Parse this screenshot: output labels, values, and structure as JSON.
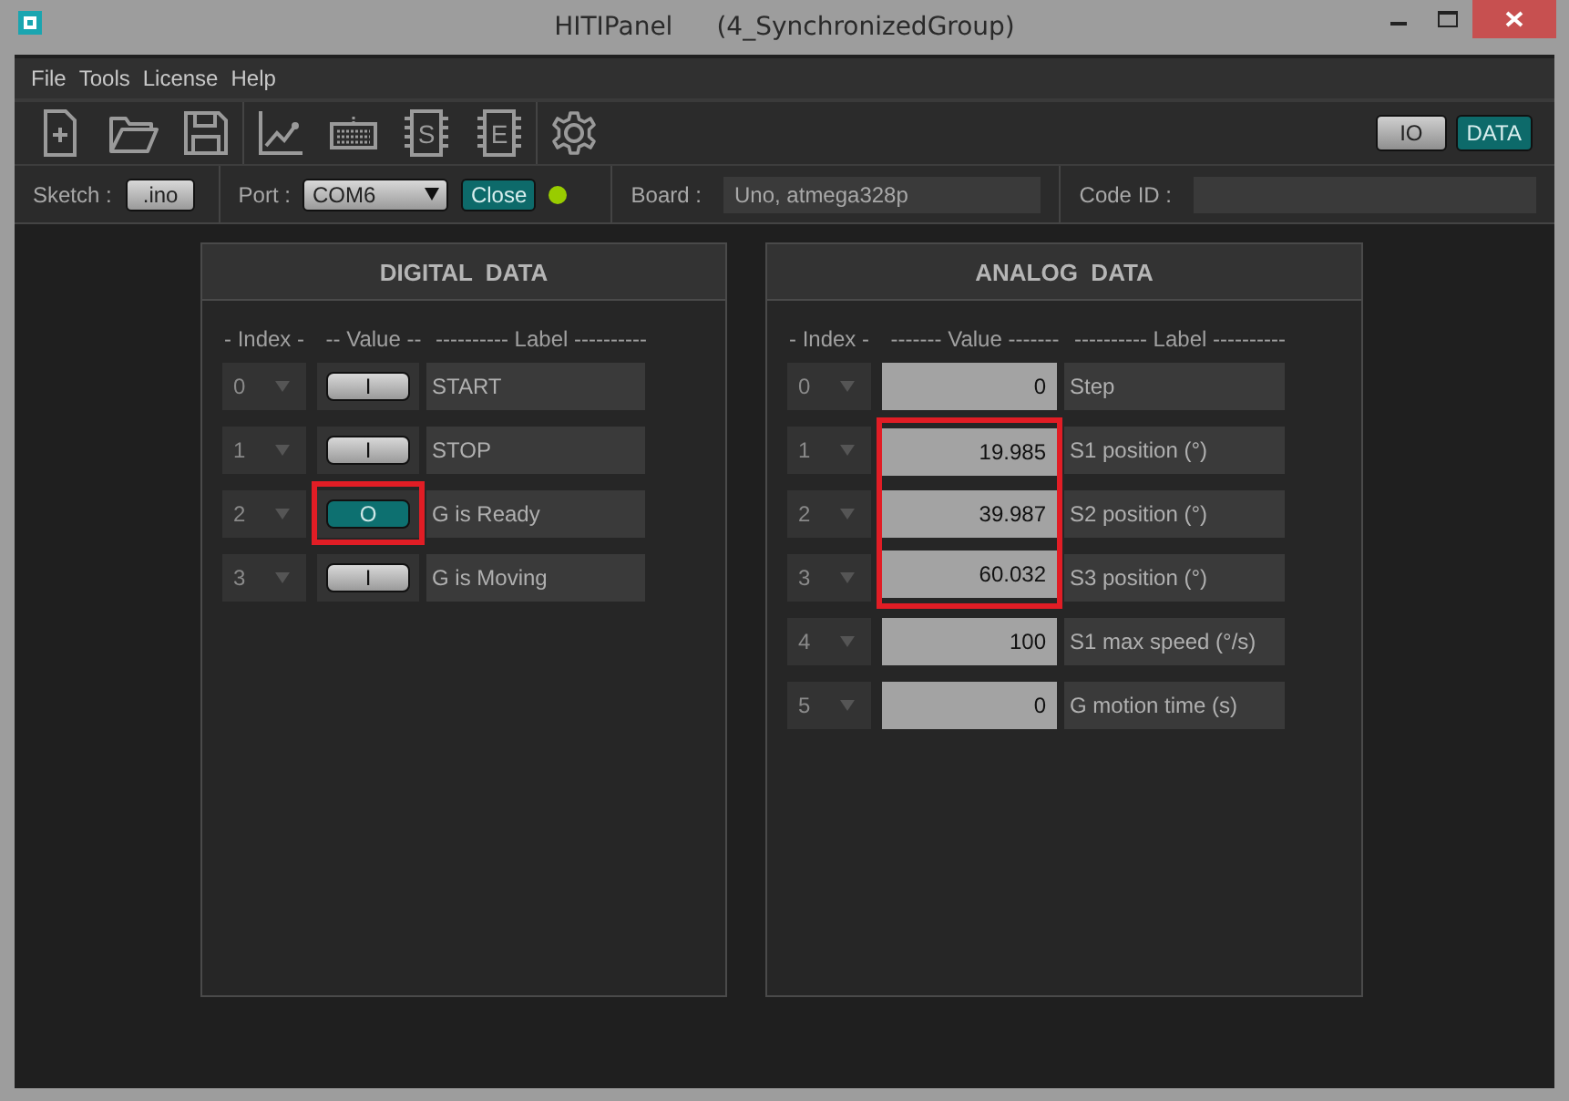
{
  "window": {
    "title": "HITIPanel",
    "document": "(4_SynchronizedGroup)"
  },
  "menu": [
    "File",
    "Tools",
    "License",
    "Help"
  ],
  "toolbar": [
    {
      "kind": "new"
    },
    {
      "kind": "open"
    },
    {
      "kind": "save"
    },
    {
      "kind": "sep"
    },
    {
      "kind": "chart"
    },
    {
      "kind": "keyboard"
    },
    {
      "kind": "chip",
      "label": "S"
    },
    {
      "kind": "chip",
      "label": "E"
    },
    {
      "kind": "sep"
    },
    {
      "kind": "gear"
    }
  ],
  "views": [
    {
      "label": "IO",
      "selected": false
    },
    {
      "label": "DATA",
      "selected": true
    }
  ],
  "connection": {
    "sketch_label": "Sketch :",
    "sketch_button": ".ino",
    "port_label": "Port :",
    "port": "COM6",
    "close_button": "Close",
    "connected": true,
    "board_label": "Board :",
    "board": "Uno, atmega328p",
    "code_id_label": "Code ID :"
  },
  "digital": {
    "title": "DIGITAL  DATA",
    "columns": [
      "- Index -",
      "-- Value --",
      "---------- Label ----------"
    ],
    "rows": [
      {
        "index": "0",
        "value": "I",
        "on": false,
        "label": "START",
        "highlighted": false
      },
      {
        "index": "1",
        "value": "I",
        "on": false,
        "label": "STOP",
        "highlighted": false
      },
      {
        "index": "2",
        "value": "O",
        "on": true,
        "label": "G is Ready",
        "highlighted": true
      },
      {
        "index": "3",
        "value": "I",
        "on": false,
        "label": "G is Moving",
        "highlighted": false
      }
    ]
  },
  "analog": {
    "title": "ANALOG  DATA",
    "columns": [
      "- Index -",
      "------- Value -------",
      "---------- Label ----------"
    ],
    "rows": [
      {
        "index": "0",
        "value": "0",
        "label": "Step",
        "highlighted": false
      },
      {
        "index": "1",
        "value": "19.985",
        "label": "S1 position (°)",
        "highlighted": true
      },
      {
        "index": "2",
        "value": "39.987",
        "label": "S2 position (°)",
        "highlighted": true
      },
      {
        "index": "3",
        "value": "60.032",
        "label": "S3 position (°)",
        "highlighted": true
      },
      {
        "index": "4",
        "value": "100",
        "label": "S1 max speed (°/s)",
        "highlighted": false
      },
      {
        "index": "5",
        "value": "0",
        "label": "G motion time (s)",
        "highlighted": false
      }
    ]
  }
}
